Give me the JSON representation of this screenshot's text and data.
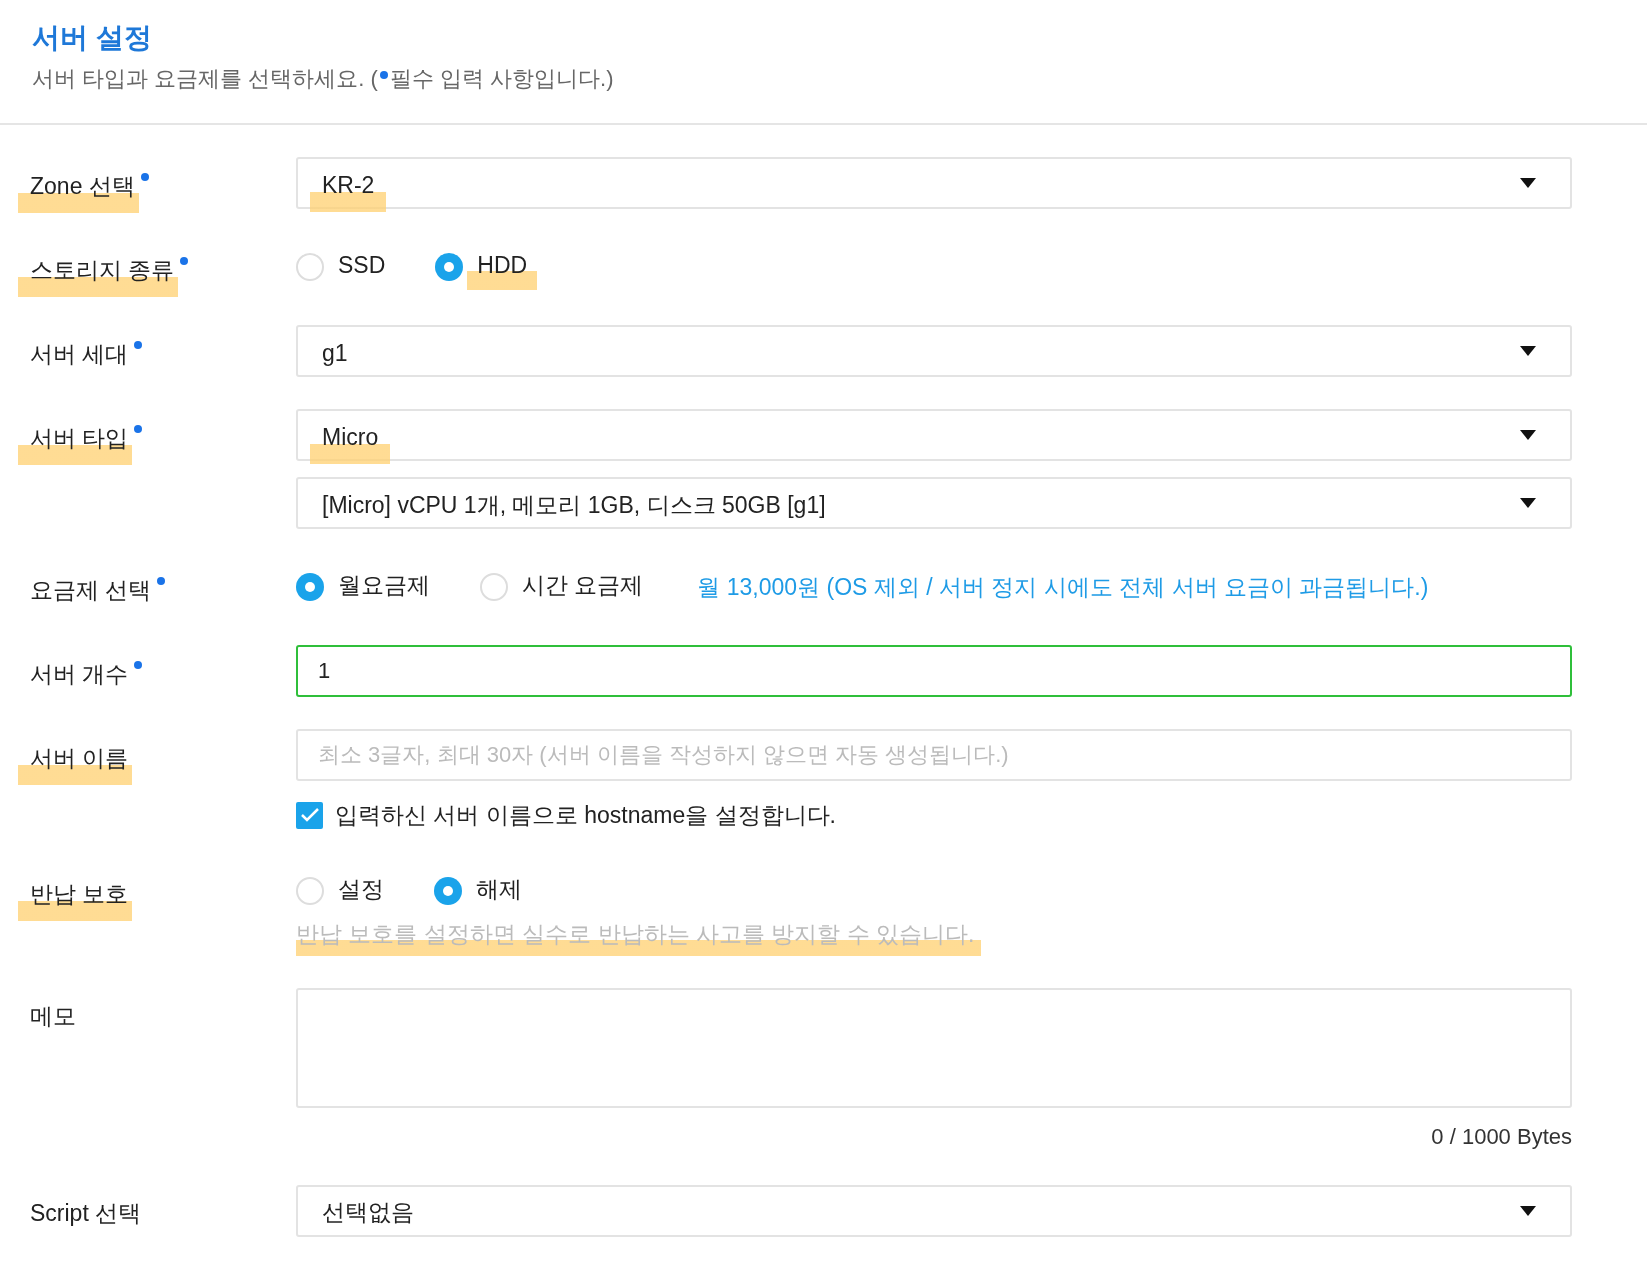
{
  "header": {
    "title": "서버 설정",
    "subtitle_before": "서버 타입과 요금제를 선택하세요. (",
    "subtitle_after": "필수 입력 사항입니다.)"
  },
  "rows": [
    {
      "label": "Zone 선택",
      "required": true,
      "highlighted": true,
      "controls": [
        {
          "kind": "select",
          "value": "KR-2",
          "highlighted": true
        }
      ]
    },
    {
      "label": "스토리지 종류",
      "required": true,
      "highlighted": true,
      "controls": [
        {
          "kind": "radios",
          "options": [
            {
              "label": "SSD",
              "selected": false,
              "highlighted": false
            },
            {
              "label": "HDD",
              "selected": true,
              "highlighted": true
            }
          ]
        }
      ]
    },
    {
      "label": "서버 세대",
      "required": true,
      "highlighted": false,
      "controls": [
        {
          "kind": "select",
          "value": "g1",
          "highlighted": false
        }
      ]
    },
    {
      "label": "서버 타입",
      "required": true,
      "highlighted": true,
      "controls": [
        {
          "kind": "select",
          "value": "Micro",
          "highlighted": true
        },
        {
          "kind": "select",
          "value": "[Micro] vCPU 1개, 메모리 1GB, 디스크 50GB [g1]",
          "highlighted": false
        }
      ]
    },
    {
      "label": "요금제 선택",
      "required": true,
      "highlighted": false,
      "controls": [
        {
          "kind": "radios",
          "options": [
            {
              "label": "월요금제",
              "selected": true,
              "highlighted": false
            },
            {
              "label": "시간 요금제",
              "selected": false,
              "highlighted": false
            }
          ],
          "note": "월 13,000원 (OS 제외 / 서버 정지 시에도 전체 서버 요금이 과금됩니다.)"
        }
      ]
    },
    {
      "label": "서버 개수",
      "required": true,
      "highlighted": false,
      "controls": [
        {
          "kind": "input",
          "value": "1",
          "focused": true
        }
      ]
    },
    {
      "label": "서버 이름",
      "required": false,
      "highlighted": true,
      "controls": [
        {
          "kind": "input",
          "placeholder": "최소 3글자, 최대 30자 (서버 이름을 작성하지 않으면 자동 생성됩니다.)",
          "focused": false
        },
        {
          "kind": "checkbox",
          "label": "입력하신 서버 이름으로 hostname을 설정합니다.",
          "checked": true
        }
      ]
    },
    {
      "label": "반납 보호",
      "required": false,
      "highlighted": true,
      "controls": [
        {
          "kind": "radios",
          "options": [
            {
              "label": "설정",
              "selected": false,
              "highlighted": false
            },
            {
              "label": "해제",
              "selected": true,
              "highlighted": false
            }
          ]
        },
        {
          "kind": "help",
          "text": "반납 보호를 설정하면 실수로 반납하는 사고를 방지할 수 있습니다.",
          "highlighted": true
        }
      ]
    },
    {
      "label": "메모",
      "required": false,
      "highlighted": false,
      "controls": [
        {
          "kind": "textarea",
          "counter": "0 / 1000 Bytes"
        }
      ]
    },
    {
      "label": "Script 선택",
      "required": false,
      "highlighted": false,
      "controls": [
        {
          "kind": "select",
          "value": "선택없음",
          "highlighted": false
        }
      ]
    }
  ]
}
